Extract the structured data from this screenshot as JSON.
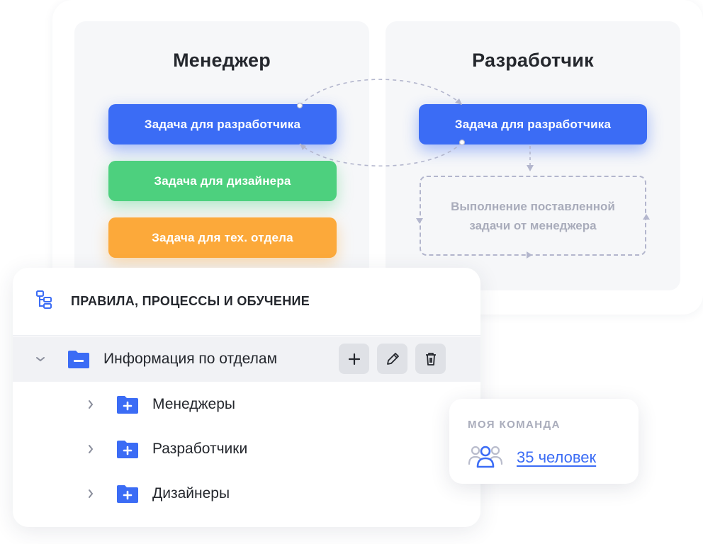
{
  "manager_panel": {
    "title": "Менеджер",
    "tasks": [
      {
        "label": "Задача для разработчика",
        "color": "#3b6cf5"
      },
      {
        "label": "Задача для дизайнера",
        "color": "#4dd07e"
      },
      {
        "label": "Задача для тех. отдела",
        "color": "#fca93a"
      }
    ]
  },
  "developer_panel": {
    "title": "Разработчик",
    "task": {
      "label": "Задача для разработчика",
      "color": "#3b6cf5"
    },
    "pending_line1": "Выполнение поставленной",
    "pending_line2": "задачи от менеджера"
  },
  "tree": {
    "title": "ПРАВИЛА, ПРОЦЕССЫ И ОБУЧЕНИЕ",
    "header_icon": "hierarchy-icon",
    "root": {
      "label": "Информация по отделам",
      "icon": "folder-minus-icon",
      "actions": [
        "add-icon",
        "pencil-icon",
        "trash-icon"
      ]
    },
    "children": [
      {
        "label": "Менеджеры",
        "icon": "folder-plus-icon"
      },
      {
        "label": "Разработчики",
        "icon": "folder-plus-icon"
      },
      {
        "label": "Дизайнеры",
        "icon": "folder-plus-icon"
      }
    ]
  },
  "team": {
    "label": "МОЯ КОМАНДА",
    "count_text": "35 человек",
    "icon": "users-icon"
  },
  "colors": {
    "accent": "#3b6cf5",
    "green": "#4dd07e",
    "orange": "#fca93a",
    "muted": "#a9acbb"
  }
}
